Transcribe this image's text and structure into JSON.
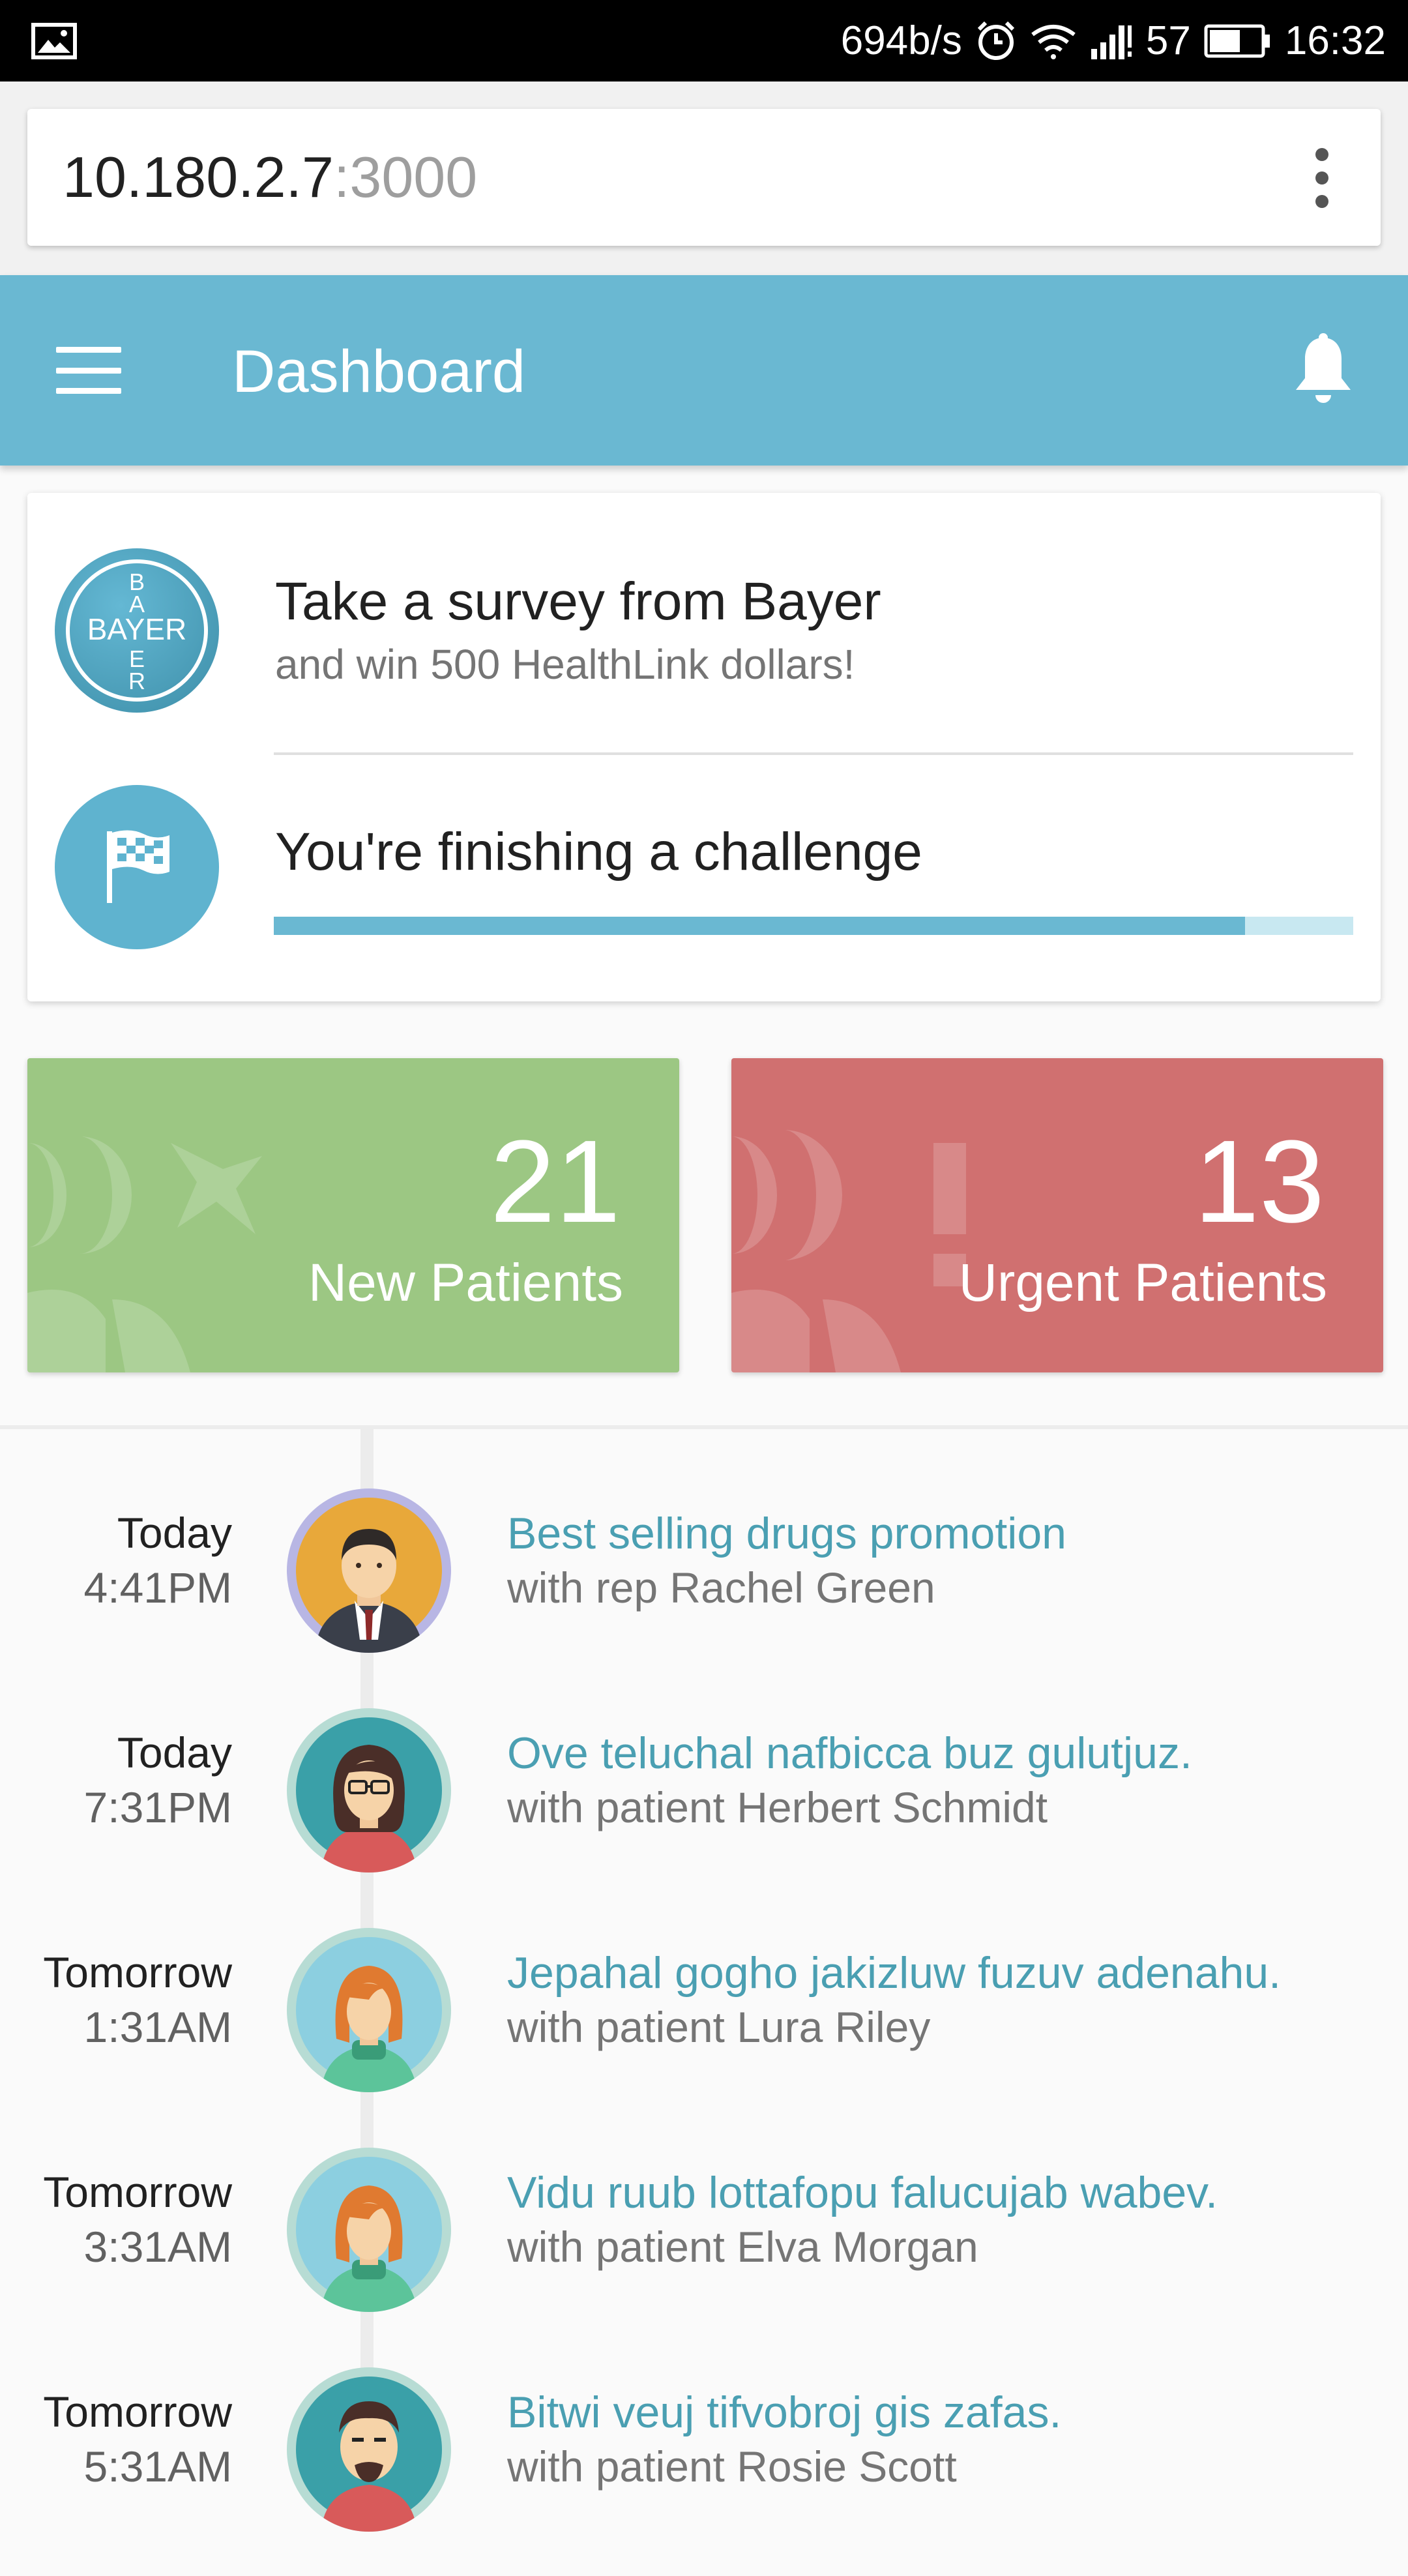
{
  "status_bar": {
    "speed": "694b/s",
    "battery": "57",
    "time": "16:32",
    "icons": [
      "image-icon",
      "alarm-icon",
      "wifi-icon",
      "signal-icon",
      "battery-icon"
    ]
  },
  "browser": {
    "url_host": "10.180.2.7",
    "url_port": ":3000"
  },
  "header": {
    "title": "Dashboard"
  },
  "notifications": {
    "survey": {
      "logo_text_h": "BAYER",
      "logo_text_v_top": "BA",
      "logo_text_v_bottom": "ER",
      "title": "Take a survey from Bayer",
      "subtitle": "and win 500 HealthLink dollars!"
    },
    "challenge": {
      "title": "You're finishing a challenge",
      "progress": 0.9
    }
  },
  "stats": {
    "new_patients": {
      "value": "21",
      "label": "New Patients",
      "color": "#9cc783"
    },
    "urgent_patients": {
      "value": "13",
      "label": "Urgent Patients",
      "color": "#d07070"
    }
  },
  "timeline": [
    {
      "day": "Today",
      "time": "4:41PM",
      "title": "Best selling drugs promotion",
      "subtitle": "with rep Rachel Green",
      "avatar": "rep-man-suit"
    },
    {
      "day": "Today",
      "time": "7:31PM",
      "title": "Ove teluchal nafbicca buz gulutjuz.",
      "subtitle": "with patient Herbert Schmidt",
      "avatar": "woman-glasses"
    },
    {
      "day": "Tomorrow",
      "time": "1:31AM",
      "title": "Jepahal gogho jakizluw fuzuv adenahu.",
      "subtitle": "with patient Lura Riley",
      "avatar": "woman-redhair"
    },
    {
      "day": "Tomorrow",
      "time": "3:31AM",
      "title": "Vidu ruub lottafopu falucujab wabev.",
      "subtitle": "with patient Elva Morgan",
      "avatar": "woman-redhair"
    },
    {
      "day": "Tomorrow",
      "time": "5:31AM",
      "title": "Bitwi veuj tifvobroj gis zafas.",
      "subtitle": "with patient Rosie Scott",
      "avatar": "man-beard"
    }
  ]
}
